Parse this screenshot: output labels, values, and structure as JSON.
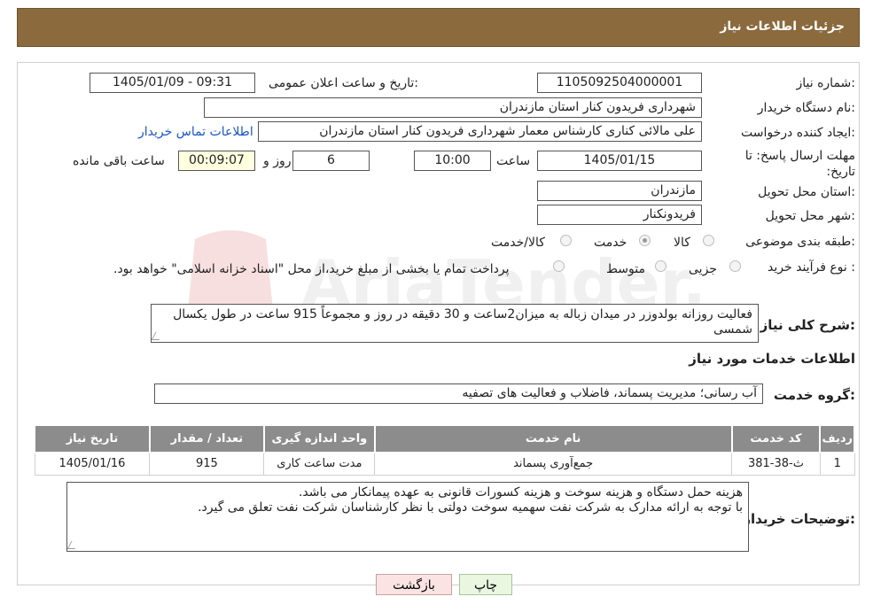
{
  "header": {
    "title": "جزئیات اطلاعات نیاز"
  },
  "form": {
    "need_number_label": "شماره نیاز:",
    "need_number": "1105092504000001",
    "announce_label": "تاریخ و ساعت اعلان عمومی:",
    "announce_value": "1405/01/09 - 09:31",
    "buyer_org_label": "نام دستگاه خریدار:",
    "buyer_org": "شهرداری فریدون کنار استان مازندران",
    "requester_label": "ایجاد کننده درخواست:",
    "requester": "علی مالائی کناری کارشناس معمار شهرداری فریدون کنار استان مازندران",
    "contact_link": "اطلاعات تماس خریدار",
    "deadline_label": "مهلت ارسال پاسخ: تا تاریخ:",
    "deadline_date": "1405/01/15",
    "time_label": "ساعت",
    "deadline_time": "10:00",
    "days_value": "6",
    "days_label": "روز و",
    "remaining_time": "00:09:07",
    "remaining_label": "ساعت باقی مانده",
    "province_label": "استان محل تحویل:",
    "province": "مازندران",
    "city_label": "شهر محل تحویل:",
    "city": "فریدونکنار",
    "category_label": "طبقه بندی موضوعی:",
    "category_options": [
      "کالا",
      "خدمت",
      "کالا/خدمت"
    ],
    "category_selected": "خدمت",
    "process_label": "نوع فرآیند خرید :",
    "process_options": [
      "جزیی",
      "متوسط"
    ],
    "process_note": "پرداخت تمام یا بخشی از مبلغ خرید،از محل \"اسناد خزانه اسلامی\" خواهد بود.",
    "summary_label": "شرح کلی نیاز:",
    "summary": "فعالیت روزانه بولدوزر در میدان زباله به میزان2ساعت و 30 دقیقه در روز و مجموعاً 915 ساعت در طول یکسال شمسی"
  },
  "services": {
    "section_title": "اطلاعات خدمات مورد نیاز",
    "group_label": "گروه خدمت:",
    "group_value": "آب رسانی؛ مدیریت پسماند، فاضلاب و فعالیت های تصفیه",
    "columns": [
      "ردیف",
      "کد خدمت",
      "نام خدمت",
      "واحد اندازه گیری",
      "تعداد / مقدار",
      "تاریخ نیاز"
    ],
    "rows": [
      [
        "1",
        "ث-38-381",
        "جمع‌آوری پسماند",
        "مدت ساعت کاری",
        "915",
        "1405/01/16"
      ]
    ]
  },
  "buyer_notes": {
    "label": "توضیحات خریدار:",
    "line1": "هزینه حمل دستگاه و هزینه سوخت و هزینه کسورات قانونی به عهده پیمانکار می باشد.",
    "line2": "با توجه به ارائه مدارک به شرکت نفت سهمیه سوخت دولتی با نظر کارشناسان شرکت نفت تعلق می گیرد."
  },
  "buttons": {
    "print": "چاپ",
    "back": "بازگشت"
  },
  "watermark": {
    "text": "AriaTender.neT"
  },
  "colors": {
    "header": "#8b6a3e",
    "table_header": "#8c8c8c",
    "link": "#1a55c9"
  }
}
